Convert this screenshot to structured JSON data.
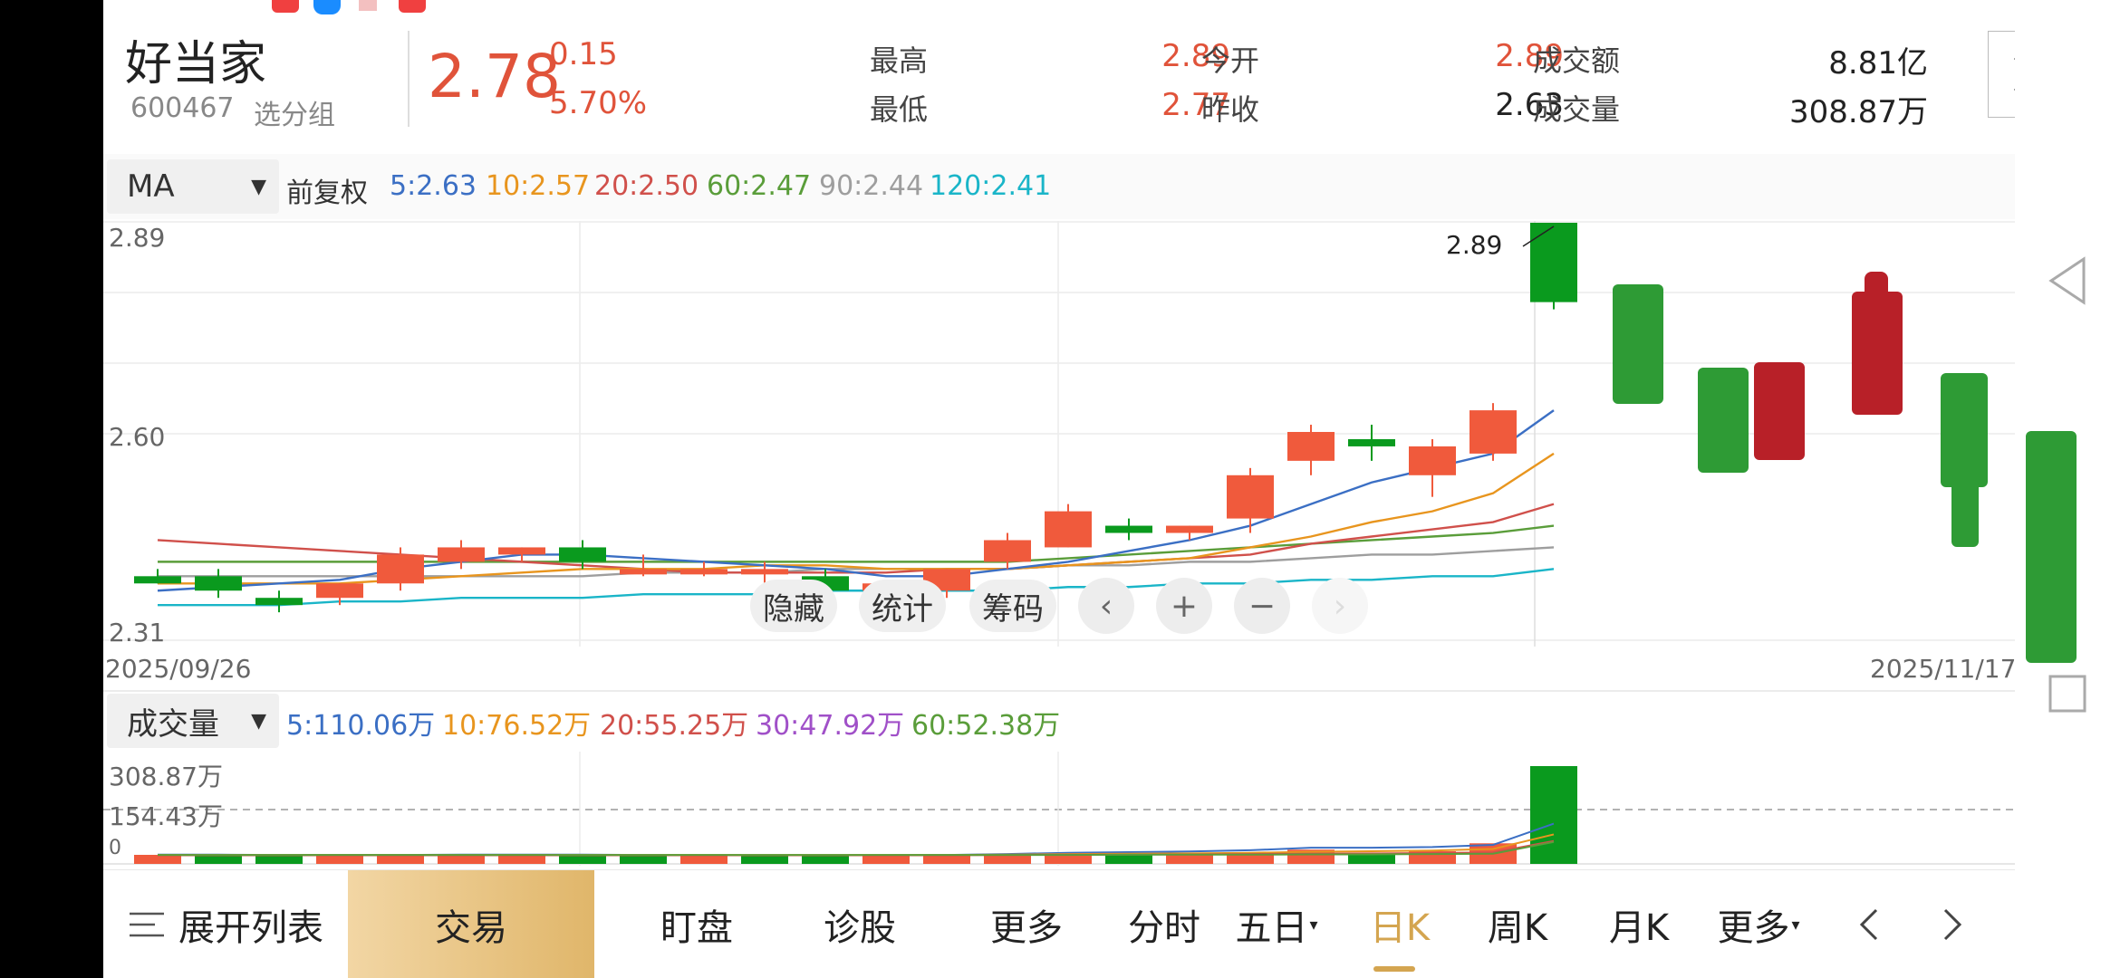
{
  "stock": {
    "name": "好当家",
    "code": "600467",
    "group": "选分组",
    "price": "2.78",
    "change": "0.15",
    "change_pct": "5.70%"
  },
  "quote": {
    "high_label": "最高",
    "high": "2.89",
    "low_label": "最低",
    "low": "2.77",
    "open_label": "今开",
    "open": "2.89",
    "prev_label": "昨收",
    "prev_close": "2.63",
    "amount_label": "成交额",
    "amount": "8.81亿",
    "volume_label": "成交量",
    "volume": "308.87万"
  },
  "ma_bar": {
    "selector": "MA",
    "adjust": "前复权",
    "items": [
      "5:2.63",
      "10:2.57",
      "20:2.50",
      "60:2.47",
      "90:2.44",
      "120:2.41"
    ],
    "colors": [
      "#3b6fc4",
      "#e8951e",
      "#d0504b",
      "#5a9d3a",
      "#9e9e9e",
      "#1ab5c8"
    ]
  },
  "vol_bar": {
    "selector": "成交量",
    "items": [
      "5:110.06万",
      "10:76.52万",
      "20:55.25万",
      "30:47.92万",
      "60:52.38万"
    ],
    "colors": [
      "#3b6fc4",
      "#e8951e",
      "#d0504b",
      "#a050c8",
      "#5a9d3a"
    ]
  },
  "price_axis": {
    "top": "2.89",
    "mid": "2.60",
    "bottom": "2.31"
  },
  "dates": {
    "start": "2025/09/26",
    "end": "2025/11/17"
  },
  "high_marker": "2.89",
  "vol_axis": {
    "top": "308.87万",
    "mid": "154.43万",
    "zero": "0"
  },
  "chart_buttons": {
    "hide": "隐藏",
    "stats": "统计",
    "chips": "筹码"
  },
  "colors": {
    "up": "#f05a3c",
    "down": "#0a9a1e",
    "accent": "#d4a550"
  },
  "chart_data": {
    "type": "candlestick",
    "ylim": [
      2.31,
      2.89
    ],
    "candles": [
      {
        "o": 2.4,
        "h": 2.41,
        "l": 2.39,
        "c": 2.39
      },
      {
        "o": 2.4,
        "h": 2.41,
        "l": 2.37,
        "c": 2.38
      },
      {
        "o": 2.37,
        "h": 2.38,
        "l": 2.35,
        "c": 2.36
      },
      {
        "o": 2.37,
        "h": 2.39,
        "l": 2.36,
        "c": 2.39
      },
      {
        "o": 2.39,
        "h": 2.44,
        "l": 2.38,
        "c": 2.43
      },
      {
        "o": 2.42,
        "h": 2.45,
        "l": 2.41,
        "c": 2.44
      },
      {
        "o": 2.43,
        "h": 2.44,
        "l": 2.42,
        "c": 2.44
      },
      {
        "o": 2.44,
        "h": 2.45,
        "l": 2.41,
        "c": 2.42
      },
      {
        "o": 2.41,
        "h": 2.43,
        "l": 2.4,
        "c": 2.41
      },
      {
        "o": 2.41,
        "h": 2.42,
        "l": 2.4,
        "c": 2.41
      },
      {
        "o": 2.41,
        "h": 2.42,
        "l": 2.37,
        "c": 2.41
      },
      {
        "o": 2.4,
        "h": 2.41,
        "l": 2.37,
        "c": 2.38
      },
      {
        "o": 2.38,
        "h": 2.39,
        "l": 2.37,
        "c": 2.39
      },
      {
        "o": 2.38,
        "h": 2.41,
        "l": 2.37,
        "c": 2.41
      },
      {
        "o": 2.42,
        "h": 2.46,
        "l": 2.41,
        "c": 2.45
      },
      {
        "o": 2.44,
        "h": 2.5,
        "l": 2.44,
        "c": 2.49
      },
      {
        "o": 2.47,
        "h": 2.48,
        "l": 2.45,
        "c": 2.46
      },
      {
        "o": 2.46,
        "h": 2.47,
        "l": 2.45,
        "c": 2.47
      },
      {
        "o": 2.48,
        "h": 2.55,
        "l": 2.46,
        "c": 2.54
      },
      {
        "o": 2.56,
        "h": 2.61,
        "l": 2.54,
        "c": 2.6
      },
      {
        "o": 2.59,
        "h": 2.61,
        "l": 2.56,
        "c": 2.58
      },
      {
        "o": 2.54,
        "h": 2.59,
        "l": 2.51,
        "c": 2.58
      },
      {
        "o": 2.57,
        "h": 2.64,
        "l": 2.56,
        "c": 2.63
      },
      {
        "o": 2.89,
        "h": 2.89,
        "l": 2.77,
        "c": 2.78
      }
    ],
    "ma": {
      "5": [
        2.38,
        2.385,
        2.39,
        2.395,
        2.41,
        2.42,
        2.43,
        2.43,
        2.425,
        2.42,
        2.415,
        2.41,
        2.4,
        2.4,
        2.41,
        2.42,
        2.435,
        2.45,
        2.47,
        2.5,
        2.53,
        2.55,
        2.57,
        2.63
      ],
      "10": [
        2.39,
        2.39,
        2.39,
        2.39,
        2.395,
        2.4,
        2.405,
        2.41,
        2.41,
        2.41,
        2.415,
        2.415,
        2.41,
        2.41,
        2.41,
        2.415,
        2.42,
        2.425,
        2.44,
        2.455,
        2.475,
        2.49,
        2.515,
        2.57
      ],
      "20": [
        2.45,
        2.445,
        2.44,
        2.435,
        2.43,
        2.425,
        2.42,
        2.415,
        2.41,
        2.405,
        2.405,
        2.405,
        2.405,
        2.41,
        2.41,
        2.415,
        2.42,
        2.425,
        2.43,
        2.445,
        2.455,
        2.465,
        2.475,
        2.5
      ],
      "60": [
        2.42,
        2.42,
        2.42,
        2.42,
        2.42,
        2.42,
        2.42,
        2.42,
        2.42,
        2.42,
        2.42,
        2.42,
        2.42,
        2.42,
        2.42,
        2.425,
        2.43,
        2.435,
        2.44,
        2.445,
        2.45,
        2.455,
        2.46,
        2.47
      ],
      "90": [
        2.4,
        2.4,
        2.4,
        2.4,
        2.4,
        2.4,
        2.4,
        2.4,
        2.405,
        2.405,
        2.405,
        2.41,
        2.41,
        2.41,
        2.41,
        2.415,
        2.415,
        2.42,
        2.42,
        2.425,
        2.43,
        2.43,
        2.435,
        2.44
      ],
      "120": [
        2.36,
        2.36,
        2.36,
        2.365,
        2.365,
        2.37,
        2.37,
        2.37,
        2.375,
        2.375,
        2.375,
        2.38,
        2.38,
        2.38,
        2.38,
        2.385,
        2.385,
        2.39,
        2.39,
        2.395,
        2.395,
        2.4,
        2.4,
        2.41
      ]
    },
    "volumes": [
      {
        "v": 12,
        "up": true
      },
      {
        "v": 10,
        "up": false
      },
      {
        "v": 8,
        "up": false
      },
      {
        "v": 9,
        "up": true
      },
      {
        "v": 14,
        "up": true
      },
      {
        "v": 13,
        "up": true
      },
      {
        "v": 12,
        "up": true
      },
      {
        "v": 11,
        "up": false
      },
      {
        "v": 9,
        "up": false
      },
      {
        "v": 8,
        "up": true
      },
      {
        "v": 10,
        "up": false
      },
      {
        "v": 9,
        "up": false
      },
      {
        "v": 10,
        "up": true
      },
      {
        "v": 12,
        "up": true
      },
      {
        "v": 30,
        "up": true
      },
      {
        "v": 32,
        "up": true
      },
      {
        "v": 18,
        "up": false
      },
      {
        "v": 16,
        "up": true
      },
      {
        "v": 35,
        "up": true
      },
      {
        "v": 45,
        "up": true
      },
      {
        "v": 22,
        "up": false
      },
      {
        "v": 40,
        "up": true
      },
      {
        "v": 65,
        "up": true
      },
      {
        "v": 308.87,
        "up": false
      }
    ],
    "vol_ylim": [
      0,
      308.87
    ]
  },
  "nav": {
    "list": "展开列表",
    "trade": "交易",
    "watch": "盯盘",
    "diagnose": "诊股",
    "more1": "更多",
    "intraday": "分时",
    "five_day": "五日",
    "daily": "日K",
    "weekly": "周K",
    "monthly": "月K",
    "more2": "更多"
  }
}
